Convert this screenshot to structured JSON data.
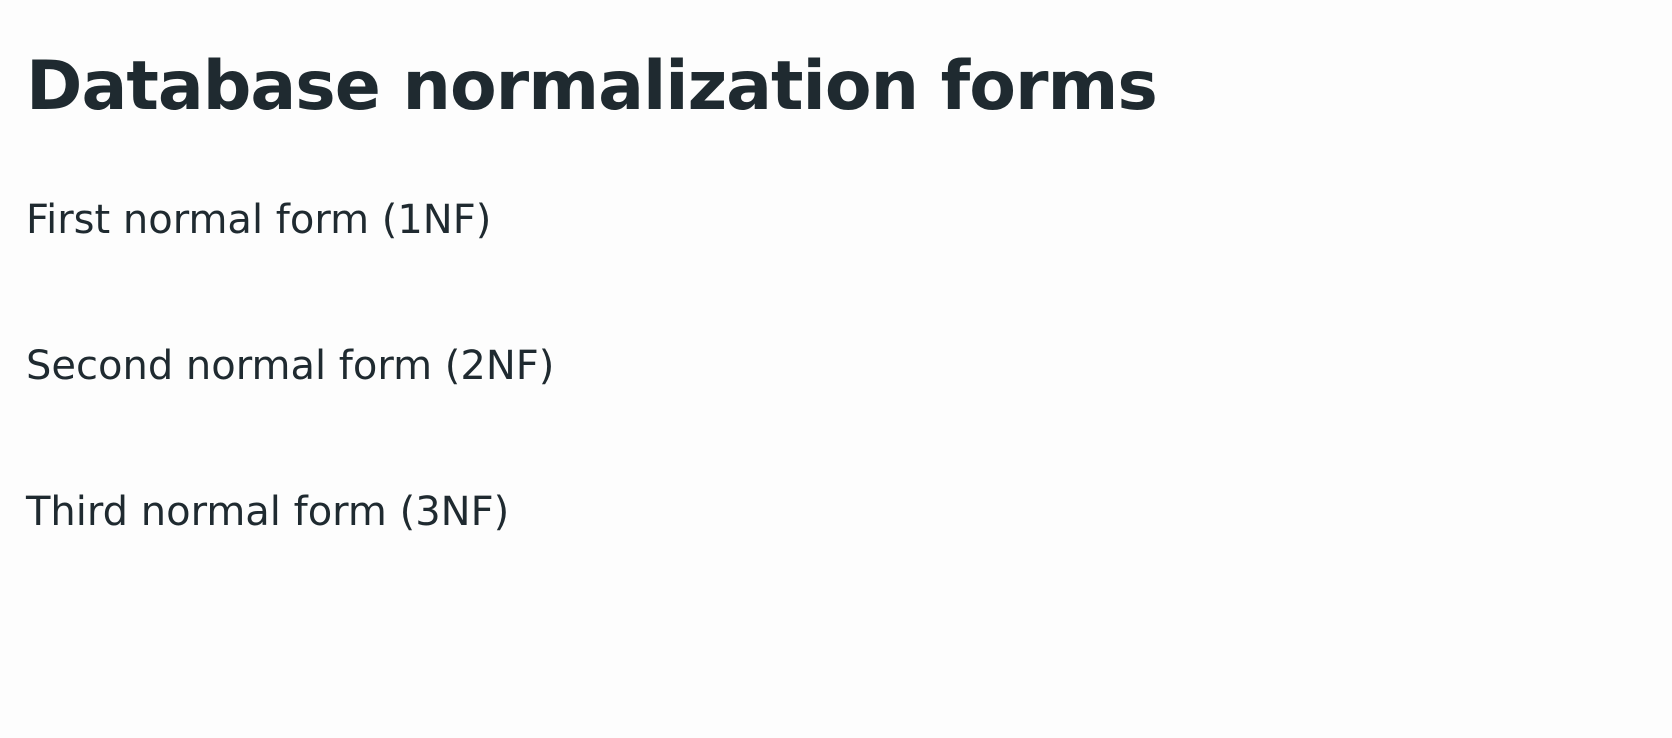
{
  "slide": {
    "title": "Database normalization forms",
    "items": [
      {
        "label": "First normal form (1NF)"
      },
      {
        "label": "Second normal form (2NF)"
      },
      {
        "label": "Third normal form (3NF)"
      }
    ]
  },
  "colors": {
    "background": "#fdfdfd",
    "text": "#1f2a30"
  }
}
